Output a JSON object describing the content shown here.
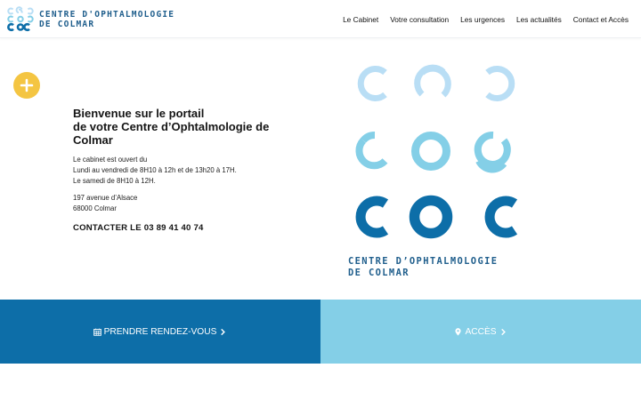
{
  "header": {
    "logo": {
      "line1": "CENTRE D'OPHTALMOLOGIE",
      "line2": "DE COLMAR"
    },
    "nav": [
      {
        "label": "Le Cabinet"
      },
      {
        "label": "Votre consultation"
      },
      {
        "label": "Les urgences"
      },
      {
        "label": "Les actualités"
      },
      {
        "label": "Contact et Accès"
      }
    ]
  },
  "intro": {
    "title_line1": "Bienvenue sur le portail",
    "title_line2": "de votre Centre d’Ophtalmologie de",
    "title_line3": "Colmar",
    "hours_line1": "Le cabinet est ouvert du",
    "hours_line2": "Lundi au vendredi de 8H10 à 12h et de 13h20 à 17H.",
    "hours_line3": "Le samedi de 8H10 à 12H.",
    "address_line1": "197 avenue d’Alsace",
    "address_line2": "68000 Colmar",
    "phone": "CONTACTER LE 03 89 41 40 74"
  },
  "big_logo": {
    "line1": "CENTRE D’OPHTALMOLOGIE",
    "line2": "DE COLMAR"
  },
  "cta": {
    "appointment": "PRENDRE RENDEZ-VOUS",
    "access": "ACCÈS"
  },
  "colors": {
    "dark_blue": "#0d6ea8",
    "light_blue": "#84cfe7",
    "pale_blue": "#b9def5",
    "yellow": "#f4c542",
    "logo_text": "#1f5e8c"
  },
  "icons": [
    "plus-icon",
    "calendar-icon",
    "chevron-right-icon",
    "map-marker-icon"
  ]
}
